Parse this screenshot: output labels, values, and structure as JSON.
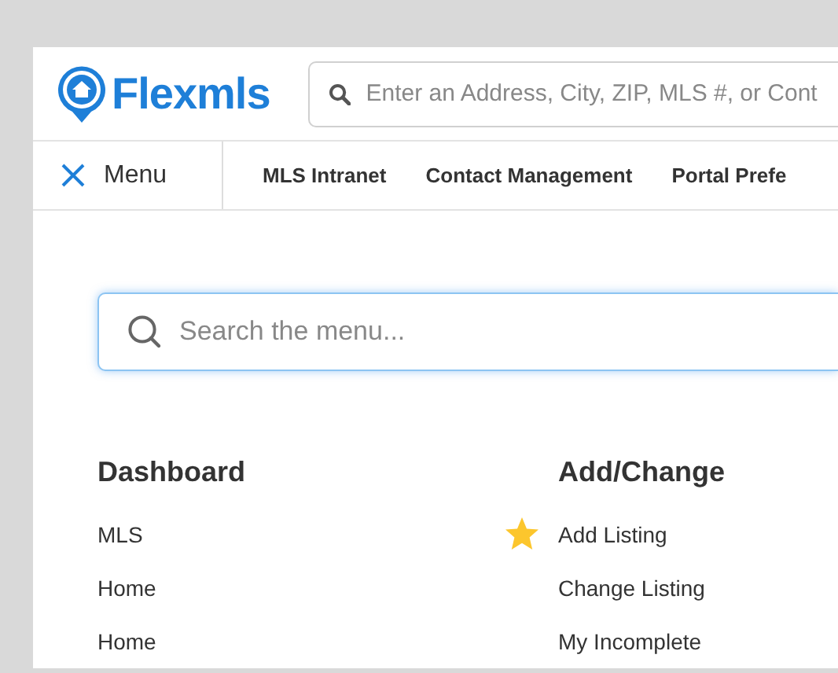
{
  "header": {
    "logo": "Flexmls",
    "search": {
      "placeholder": "Enter an Address, City, ZIP, MLS #, or Cont"
    }
  },
  "nav": {
    "menu_label": "Menu",
    "links": [
      "MLS Intranet",
      "Contact Management",
      "Portal Prefe"
    ]
  },
  "menu_search": {
    "placeholder": "Search the menu..."
  },
  "columns": [
    {
      "heading": "Dashboard",
      "items": [
        {
          "label": "MLS",
          "favorite": false
        },
        {
          "label": "Home",
          "favorite": false
        },
        {
          "label": "Home",
          "favorite": false
        }
      ]
    },
    {
      "heading": "Add/Change",
      "items": [
        {
          "label": "Add Listing",
          "favorite": true
        },
        {
          "label": "Change Listing",
          "favorite": false
        },
        {
          "label": "My Incomplete",
          "favorite": false
        }
      ]
    }
  ]
}
